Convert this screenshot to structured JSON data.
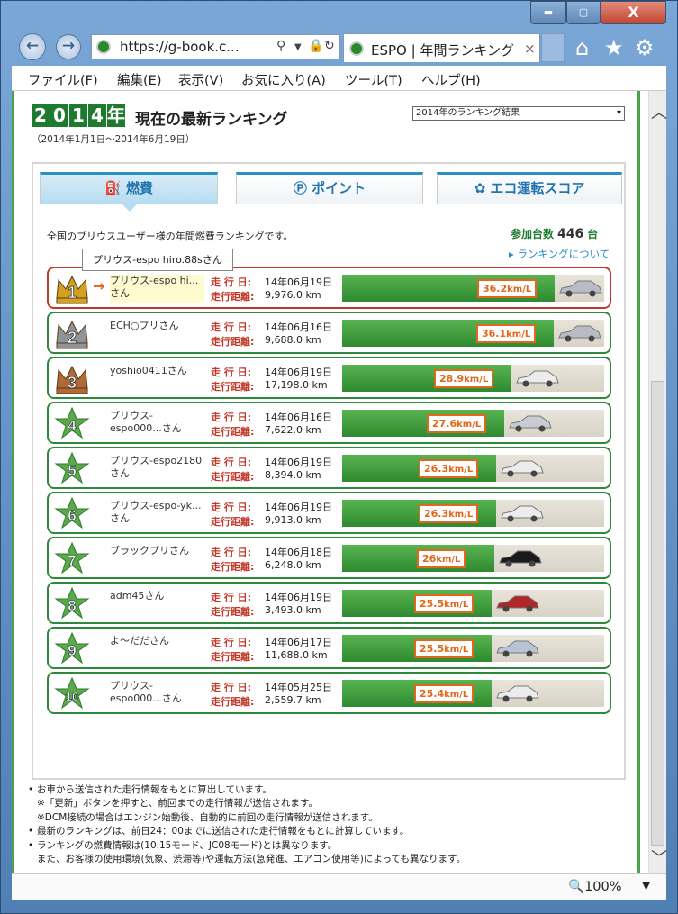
{
  "window": {
    "min_icon": "minimize-icon",
    "max_icon": "maximize-icon",
    "close_label": "X"
  },
  "browser": {
    "url": "https://g-book.c...",
    "tab_title": "ESPO | 年間ランキング",
    "tab_close": "×",
    "zoom": "100%"
  },
  "menu": [
    "ファイル(F)",
    "編集(E)",
    "表示(V)",
    "お気に入り(A)",
    "ツール(T)",
    "ヘルプ(H)"
  ],
  "page": {
    "year_digits": [
      "2",
      "0",
      "1",
      "4",
      "年"
    ],
    "headline": "現在の最新ランキング",
    "date_range": "（2014年1月1日～2014年6月19日）",
    "year_select": "2014年のランキング結果",
    "tabs": [
      "燃費",
      "ポイント",
      "エコ運転スコア"
    ],
    "intro": "全国のプリウスユーザー様の年間燃費ランキングです。",
    "count_label": "参加台数",
    "count_value": "446",
    "count_unit": "台",
    "about_link": "ランキングについて",
    "tooltip": "プリウス-espo hiro.88sさん",
    "label_date": "走 行 日:",
    "label_dist": "走行距離:",
    "notes": [
      "お車から送信された走行情報をもとに算出しています。",
      "※「更新」ボタンを押すと、前回までの走行情報が送信されます。",
      "※DCM接続の場合はエンジン始動後、自動的に前回の走行情報が送信されます。",
      "最新のランキングは、前日24：00までに送信された走行情報をもとに計算しています。",
      "ランキングの燃費情報は(10.15モード、JC08モード)とは異なります。",
      "また、お客様の使用環境(気象、渋滞等)や運転方法(急発進、エアコン使用等)によっても異なります。"
    ]
  },
  "chart_data": {
    "type": "bar",
    "title": "",
    "ylabel": "km/L",
    "categories": [
      "1",
      "2",
      "3",
      "4",
      "5",
      "6",
      "7",
      "8",
      "9",
      "10"
    ],
    "rows": [
      {
        "rank": "1",
        "name": "プリウス-espo hi...さん",
        "date": "14年06月19日",
        "distance": "9,976.0 km",
        "value": 36.2,
        "label": "36.2",
        "car": "#b8bcc4"
      },
      {
        "rank": "2",
        "name": "ECH○プリさん",
        "date": "14年06月16日",
        "distance": "9,688.0 km",
        "value": 36.1,
        "label": "36.1",
        "car": "#b8bcc4"
      },
      {
        "rank": "3",
        "name": "yoshio0411さん",
        "date": "14年06月19日",
        "distance": "17,198.0 km",
        "value": 28.9,
        "label": "28.9",
        "car": "#ececec"
      },
      {
        "rank": "4",
        "name": "プリウス-espo000...さん",
        "date": "14年06月16日",
        "distance": "7,622.0 km",
        "value": 27.6,
        "label": "27.6",
        "car": "#c8ccd2"
      },
      {
        "rank": "5",
        "name": "プリウス-espo2180さん",
        "date": "14年06月19日",
        "distance": "8,394.0 km",
        "value": 26.3,
        "label": "26.3",
        "car": "#ececec"
      },
      {
        "rank": "6",
        "name": "プリウス-espo-yk...さん",
        "date": "14年06月19日",
        "distance": "9,913.0 km",
        "value": 26.3,
        "label": "26.3",
        "car": "#ececec"
      },
      {
        "rank": "7",
        "name": "ブラックプリさん",
        "date": "14年06月18日",
        "distance": "6,248.0 km",
        "value": 26,
        "label": "26",
        "car": "#1a1a1a"
      },
      {
        "rank": "8",
        "name": "adm45さん",
        "date": "14年06月19日",
        "distance": "3,493.0 km",
        "value": 25.5,
        "label": "25.5",
        "car": "#b0262a"
      },
      {
        "rank": "9",
        "name": "よ〜だださん",
        "date": "14年06月17日",
        "distance": "11,688.0 km",
        "value": 25.5,
        "label": "25.5",
        "car": "#b8c4d6"
      },
      {
        "rank": "10",
        "name": "プリウス-espo000...さん",
        "date": "14年05月25日",
        "distance": "2,559.7 km",
        "value": 25.4,
        "label": "25.4",
        "car": "#ececec"
      }
    ],
    "unit": "km/L",
    "ylim": [
      0,
      50
    ]
  }
}
